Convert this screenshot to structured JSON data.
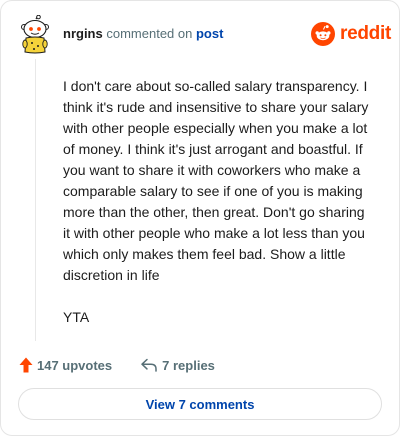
{
  "header": {
    "username": "nrgins",
    "action": "commented on",
    "link_label": "post",
    "brand_name": "reddit",
    "brand_color": "#ff4500",
    "avatar_icon": "snoo-avatar-icon",
    "brand_icon": "reddit-snoo-icon"
  },
  "comment": {
    "paragraph": "I don't care about so-called salary transparency. I think it's rude and insensitive to share your salary with other people especially when you make a lot of money. I think it's just arrogant and boastful. If you want to share it with coworkers who make a comparable salary to see if one of you is making more than the other, then great. Don't go sharing it with other people who make a lot less than you which only makes them feel bad. Show a little discretion in life",
    "verdict": "YTA"
  },
  "actions": {
    "upvotes_label": "147 upvotes",
    "replies_label": "7 replies",
    "upvote_icon": "upvote-arrow-icon",
    "reply_icon": "reply-arrow-icon",
    "upvote_color": "#ff4500"
  },
  "footer": {
    "view_comments_label": "View 7 comments",
    "link_color": "#0045ac"
  }
}
